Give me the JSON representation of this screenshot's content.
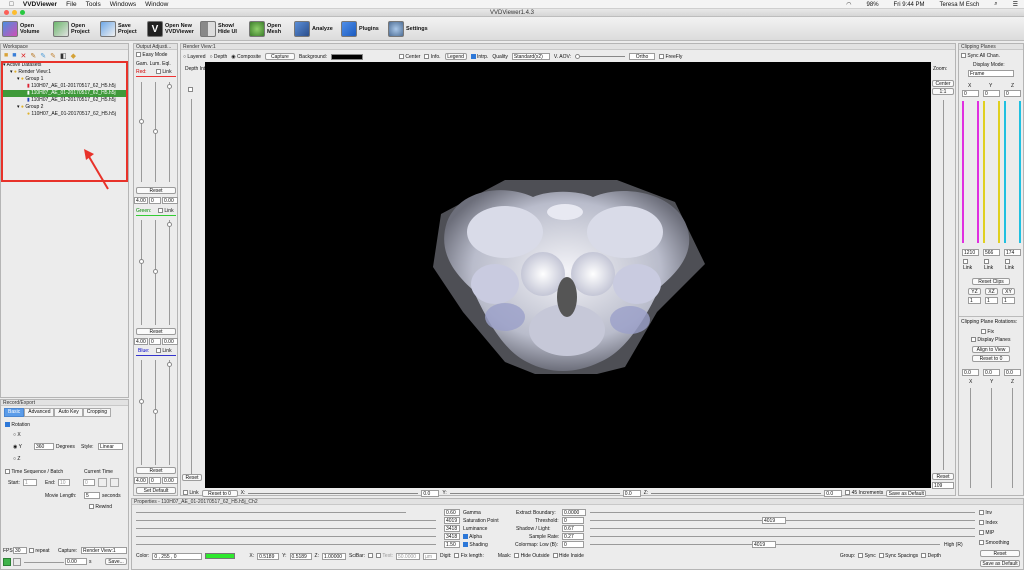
{
  "menubar": {
    "app": "VVDViewer",
    "items": [
      "File",
      "Tools",
      "Windows",
      "Window"
    ],
    "battery": "98%",
    "clock": "Fri 9:44 PM",
    "user": "Teresa M Esch"
  },
  "window": {
    "title": "VVDViewer1.4.3"
  },
  "toolbar": {
    "open_volume": "Open Volume",
    "open_project": "Open Project",
    "save_project": "Save Project",
    "open_new_viewer": "Open New VVDViewer",
    "show_hide_ui": "Show/ Hide UI",
    "open_mesh": "Open Mesh",
    "analyze": "Analyze",
    "plugins": "Plugins",
    "settings": "Settings"
  },
  "workspace": {
    "title": "Workspace",
    "root": "Active Datasets",
    "view": "Render View:1",
    "group1": "Group 1",
    "group1_items": [
      "110H07_AE_01-20170517_62_H5.h5j",
      "110H07_AE_01-20170517_62_H5.h5j"
    ],
    "group2": "Group 2",
    "group2_items": [
      "110H07_AE_01-20170517_62_H5.h5j"
    ]
  },
  "output": {
    "title": "Output Adjusti...",
    "easy_mode": "Easy Mode",
    "cols": "Gam. Lum. Eql.",
    "red": "Red:",
    "green": "Green:",
    "blue": "Blue:",
    "link": "Link",
    "reset": "Reset",
    "vals": [
      "4.00",
      "0",
      "0.00"
    ],
    "set_default": "Set Default"
  },
  "render": {
    "title": "Render View:1",
    "layered": "Layered",
    "depth": "Depth",
    "composite": "Composite",
    "capture": "Capture",
    "background": "Background:",
    "center": "Center",
    "info": "Info.",
    "legend": "Legend",
    "interp": "Intrp.",
    "quality": "Quality",
    "quality_val": "Standard(x2)",
    "vaov": "V. AOV:",
    "ortho": "Ortho",
    "freefly": "FreeFly",
    "depth_int": "Depth Int:",
    "zoom": "Zoom:",
    "center_btn": "Center",
    "ratio": "1:1",
    "reset": "Reset",
    "zoom_val": "109",
    "link": "Link",
    "reset_to": "Reset to 0",
    "x": "X:",
    "y": "Y:",
    "z": "Z:",
    "zero": "0.0",
    "inc": "45 Increments",
    "save_default": "Save as Default"
  },
  "clipping": {
    "title": "Clipping Planes",
    "sync": "Sync All Chan.",
    "display_mode": "Display Mode:",
    "mode": "Frame",
    "x": "X",
    "y": "Y",
    "z": "Z",
    "zero": "0",
    "xmax": "1210",
    "ymax": "566",
    "zmax": "174",
    "link": "Link",
    "reset_clips": "Reset Clips",
    "yz": "YZ",
    "xz": "XZ",
    "xy": "XY",
    "one": "1",
    "rot_title": "Clipping Plane Rotations:",
    "fix": "Fix",
    "display_planes": "Display Planes",
    "align": "Align to View",
    "reset0": "Reset to 0",
    "rot_zero": "0.0"
  },
  "record": {
    "title": "Record/Export",
    "tabs": [
      "Basic",
      "Advanced",
      "Auto Key",
      "Cropping"
    ],
    "rotation": "Rotation",
    "x": "X",
    "y": "Y",
    "z": "Z",
    "degrees_val": "360",
    "degrees": "Degrees",
    "style": "Style:",
    "style_val": "Linear",
    "time_seq": "Time Sequence / Batch",
    "current_time": "Current Time",
    "start": "Start:",
    "start_val": "1",
    "end": "End:",
    "end_val": "10",
    "cur_val": "0",
    "movie_length": "Movie Length:",
    "movie_val": "5",
    "seconds": "seconds",
    "rewind": "Rewind",
    "fps": "FPS:",
    "fps_val": "30",
    "repeat": "repeat",
    "capture": "Capture:",
    "capture_val": "Render View:1",
    "time": "0.00",
    "s": "s",
    "save": "Save..."
  },
  "properties": {
    "title": "Properties - 110H07_AE_01-20170517_62_H5.h5j_Ch2",
    "gamma": "Gamma",
    "gamma_val": "0.60",
    "sat": "Saturation Point",
    "sat_val": "4019",
    "lum": "Luminance",
    "lum_val": "3418",
    "alpha": "Alpha",
    "alpha_val": "1.50",
    "shading": "Shading",
    "extract": "Extract Boundary:",
    "extract_val": "0.0000",
    "threshold": "Threshold:",
    "threshold_val": "0",
    "threshold_hi": "4019",
    "shadow": "Shadow / Light:",
    "shadow_val": "0.67",
    "sample": "Sample Rate:",
    "sample_val": "0.27",
    "colormap": "Colormap: Low (B):",
    "colormap_val": "0",
    "colormap_hi": "4019",
    "high": "High (R)",
    "inv": "Inv",
    "index": "Index",
    "mip": "MIP",
    "smoothing": "Smoothing",
    "reset": "Reset",
    "save_default": "Save as Default",
    "color": "Color:",
    "color_val": "0 , 255 , 0",
    "color_hex": "#2ee82e",
    "xs": "X:",
    "xs_val": "0.5189",
    "ys": "Y:",
    "ys_val": "0.5189",
    "zs": "Z:",
    "zs_val": "1.00000",
    "scibar": "SciBar:",
    "text": "Text:",
    "text_val": "50.0000",
    "unit": "µm",
    "digit": "Digit:",
    "fix_length": "Fix length:",
    "mask": "Mask:",
    "hide_outside": "Hide Outside",
    "hide_inside": "Hide Inside",
    "group": "Group:",
    "sync": "Sync",
    "sync_spacing": "Sync Spacings",
    "depth": "Depth"
  }
}
